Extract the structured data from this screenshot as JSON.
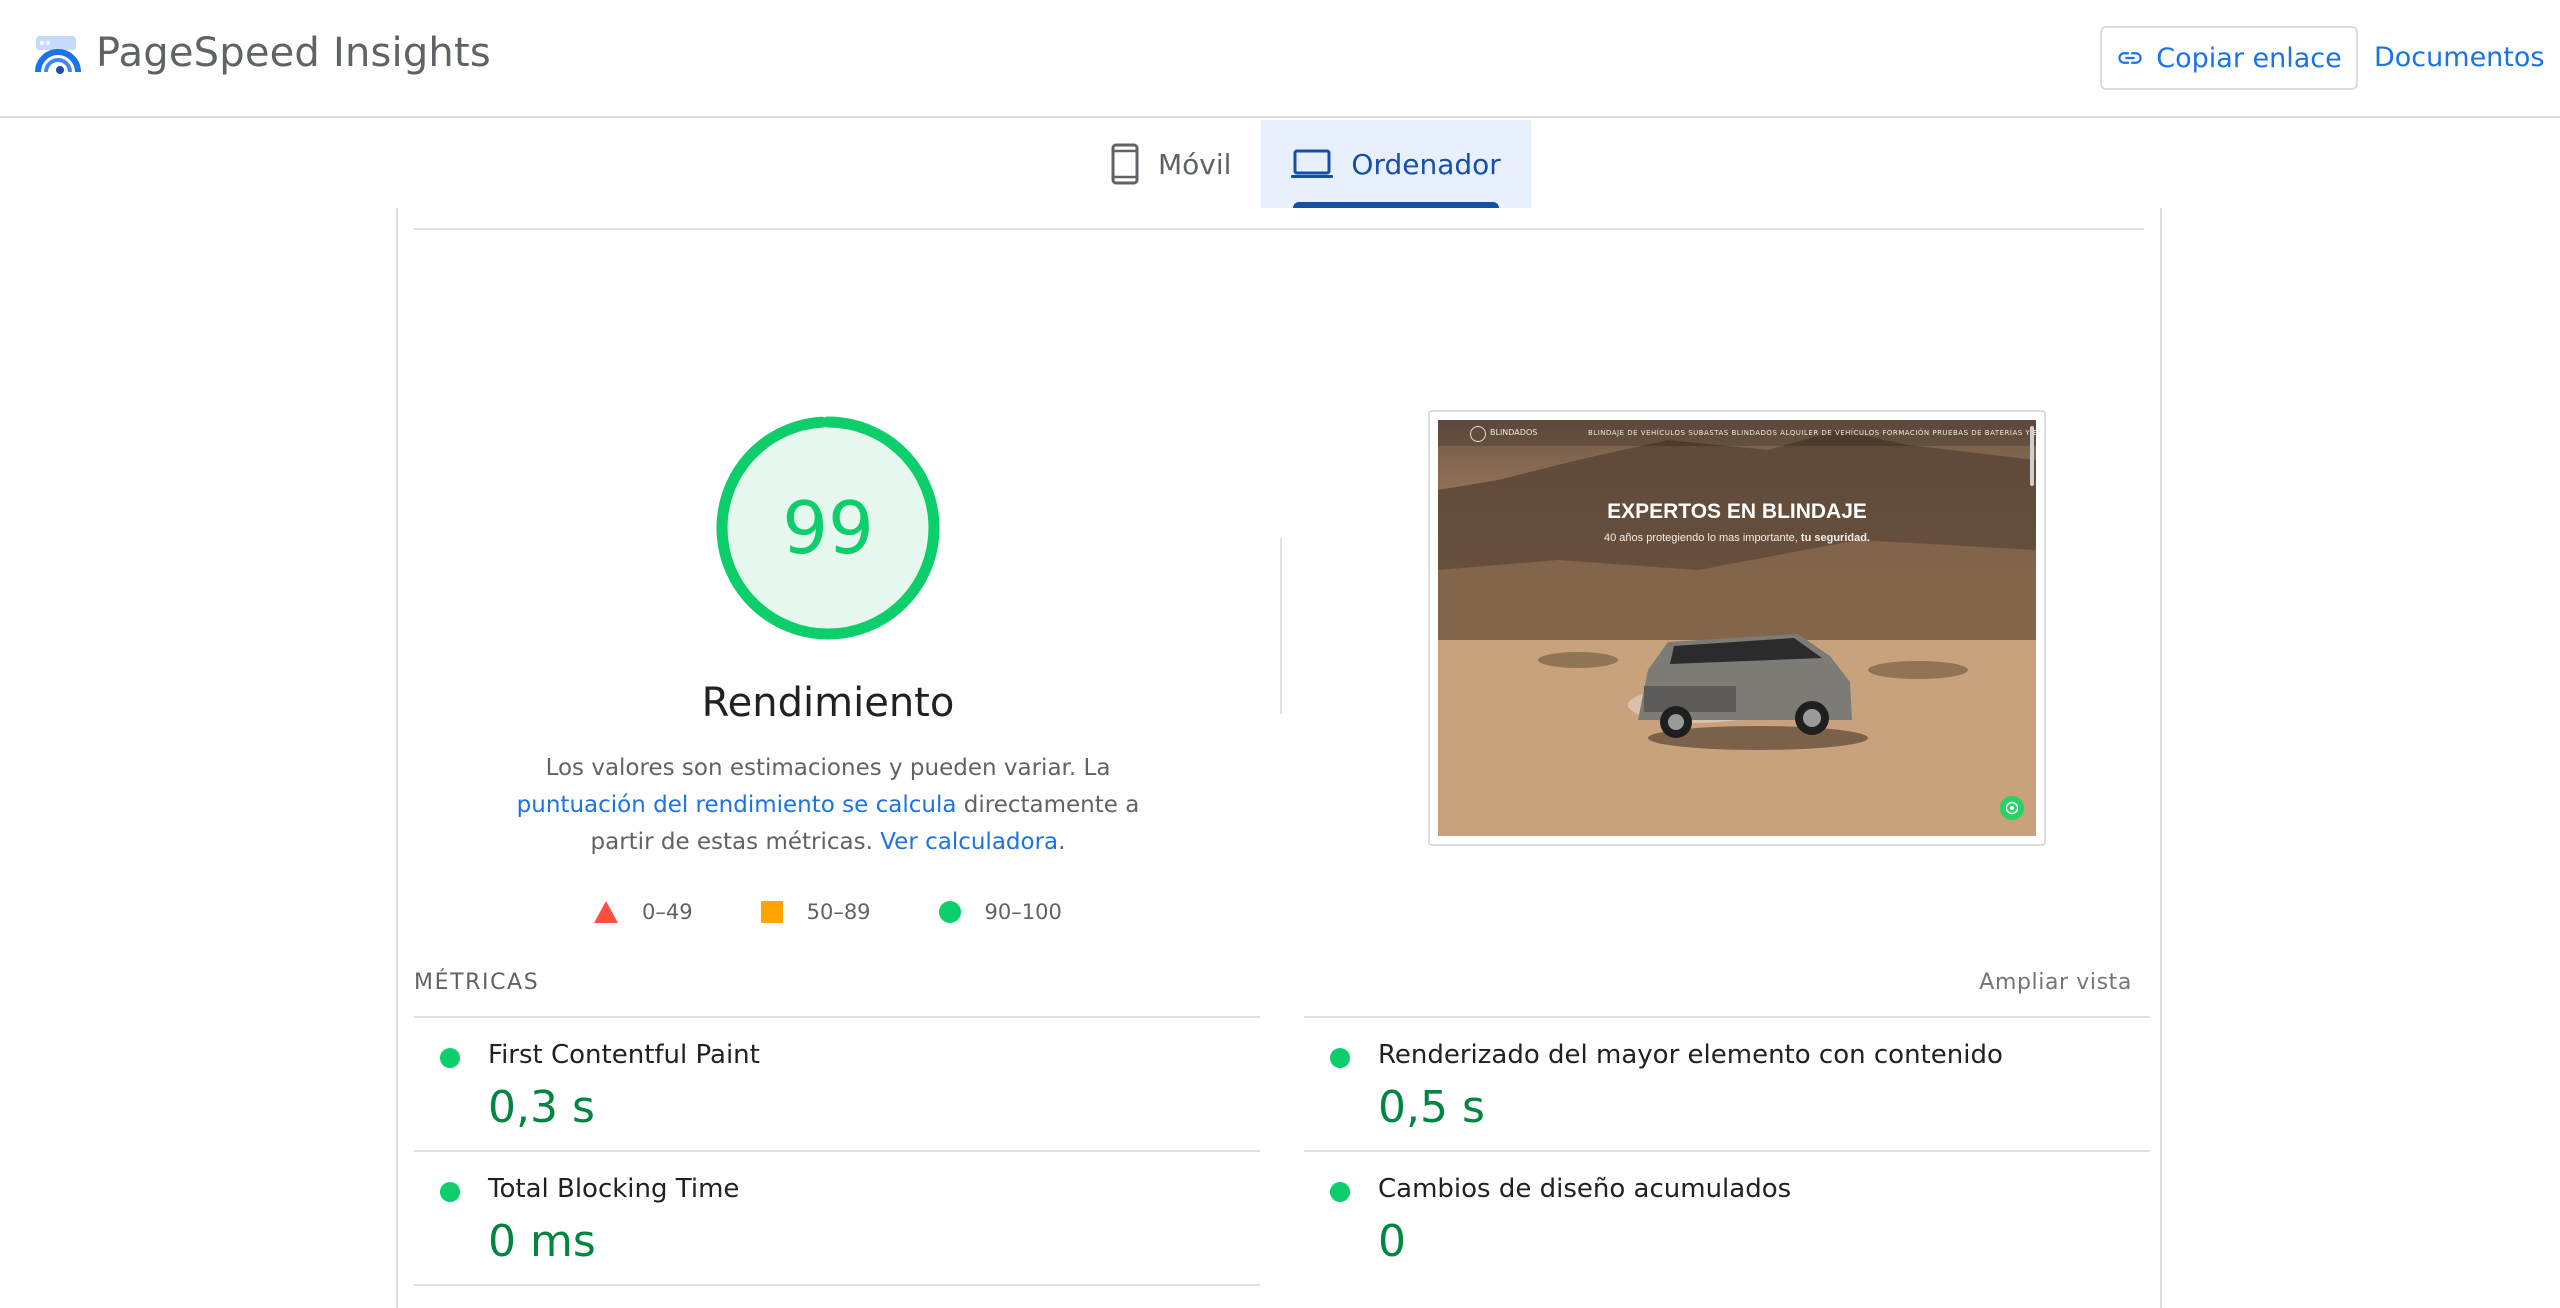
{
  "header": {
    "app_title": "PageSpeed Insights",
    "copy_link_label": "Copiar enlace",
    "docs_label": "Documentos",
    "logo_icon": "pagespeed-logo-icon",
    "link_icon": "link-icon"
  },
  "tabs": [
    {
      "label": "Móvil",
      "icon": "smartphone-icon",
      "active": false
    },
    {
      "label": "Ordenador",
      "icon": "laptop-icon",
      "active": true
    }
  ],
  "performance": {
    "score": "99",
    "category_title": "Rendimiento",
    "description_prefix": "Los valores son estimaciones y pueden variar. La ",
    "description_link1": "puntuación del rendimiento se calcula",
    "description_middle": " directamente a partir de estas métricas. ",
    "description_link2": "Ver calculadora",
    "description_suffix": ".",
    "legend": [
      {
        "range": "0–49",
        "shape": "triangle",
        "color": "#ff4e42"
      },
      {
        "range": "50–89",
        "shape": "square",
        "color": "#ffa400"
      },
      {
        "range": "90–100",
        "shape": "circle",
        "color": "#0cce6b"
      }
    ],
    "score_color": "#0cce6b"
  },
  "screenshot": {
    "hero_title": "EXPERTOS EN BLINDAJE",
    "hero_sub_prefix": "40 años protegiendo lo mas importante, ",
    "hero_sub_bold": "tu seguridad.",
    "nav_brand": "BLINDADOS",
    "nav_links": "BLINDAJE DE VEHÍCULOS     SUBASTAS BLINDADOS     ALQUILER DE VEHÍCULOS     FORMACIÓN     PRUEBAS DE BATERÍAS Y BLINDAJES"
  },
  "metrics": {
    "header": "MÉTRICAS",
    "expand_label": "Ampliar vista",
    "items": [
      {
        "name": "First Contentful Paint",
        "value": "0,3 s",
        "status": "good"
      },
      {
        "name": "Renderizado del mayor elemento con contenido",
        "value": "0,5 s",
        "status": "good"
      },
      {
        "name": "Total Blocking Time",
        "value": "0 ms",
        "status": "good"
      },
      {
        "name": "Cambios de diseño acumulados",
        "value": "0",
        "status": "good"
      }
    ]
  }
}
